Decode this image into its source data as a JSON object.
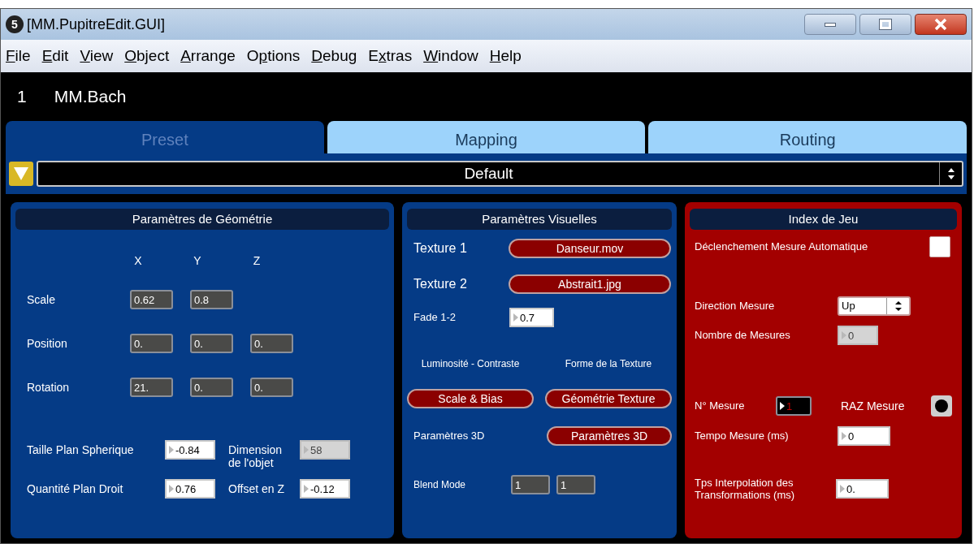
{
  "window": {
    "title": "[MM.PupitreEdit.GUI]",
    "badge": "5"
  },
  "menu": [
    {
      "accel": "F",
      "rest": "ile"
    },
    {
      "accel": "E",
      "rest": "dit"
    },
    {
      "accel": "V",
      "rest": "iew"
    },
    {
      "accel": "O",
      "rest": "bject"
    },
    {
      "accel": "A",
      "rest": "rrange"
    },
    {
      "pre": "O",
      "accel": "p",
      "rest": "tions"
    },
    {
      "accel": "D",
      "rest": "ebug"
    },
    {
      "pre": "E",
      "accel": "x",
      "rest": "tras"
    },
    {
      "accel": "W",
      "rest": "indow"
    },
    {
      "accel": "H",
      "rest": "elp"
    }
  ],
  "patch": {
    "number": "1",
    "name": "MM.Bach"
  },
  "tabs": [
    {
      "label": "Preset",
      "selected": true
    },
    {
      "label": "Mapping",
      "selected": false
    },
    {
      "label": "Routing",
      "selected": false
    }
  ],
  "preset_menu": {
    "value": "Default"
  },
  "geometry": {
    "title": "Paramètres de Géométrie",
    "axes": [
      "X",
      "Y",
      "Z"
    ],
    "rows": [
      {
        "label": "Scale",
        "values": [
          "0.62",
          "0.8"
        ]
      },
      {
        "label": "Position",
        "values": [
          "0.",
          "0.",
          "0."
        ]
      },
      {
        "label": "Rotation",
        "values": [
          "21.",
          "0.",
          "0."
        ]
      }
    ],
    "fields": [
      {
        "label": "Taille Plan Spherique",
        "value": "-0.84",
        "kind": "white"
      },
      {
        "label": "Dimension de l'objet",
        "value": "58",
        "kind": "disabled"
      },
      {
        "label": "Quantité Plan Droit",
        "value": "0.76",
        "kind": "white"
      },
      {
        "label": "Offset en Z",
        "value": "-0.12",
        "kind": "white"
      }
    ]
  },
  "visual": {
    "title": "Paramètres Visuelles",
    "textures": [
      {
        "label": "Texture 1",
        "file": "Danseur.mov"
      },
      {
        "label": "Texture 2",
        "file": "Abstrait1.jpg"
      }
    ],
    "fade": {
      "label": "Fade 1-2",
      "value": "0.7"
    },
    "groups": [
      {
        "label": "Luminosité - Contraste",
        "button": "Scale & Bias"
      },
      {
        "label": "Forme de la Texture",
        "button": "Géométrie Texture"
      }
    ],
    "params3d": {
      "label": "Paramètres 3D",
      "button": "Paramètres 3D"
    },
    "blend": {
      "label": "Blend Mode",
      "values": [
        "1",
        "1"
      ]
    }
  },
  "index": {
    "title": "Index de Jeu",
    "auto": {
      "label": "Déclenchement Mesure Automatique",
      "checked": false
    },
    "direction": {
      "label": "Direction Mesure",
      "value": "Up"
    },
    "count": {
      "label": "Nombre de Mesures",
      "value": "0",
      "kind": "disabled"
    },
    "measure": {
      "label": "N° Mesure",
      "value": "1",
      "kind": "black"
    },
    "reset": {
      "label": "RAZ Mesure"
    },
    "tempo": {
      "label": "Tempo Mesure (ms)",
      "value": "0",
      "kind": "white"
    },
    "interp": {
      "label": "Tps Interpolation des Transformations (ms)",
      "value": "0.",
      "kind": "white"
    }
  }
}
